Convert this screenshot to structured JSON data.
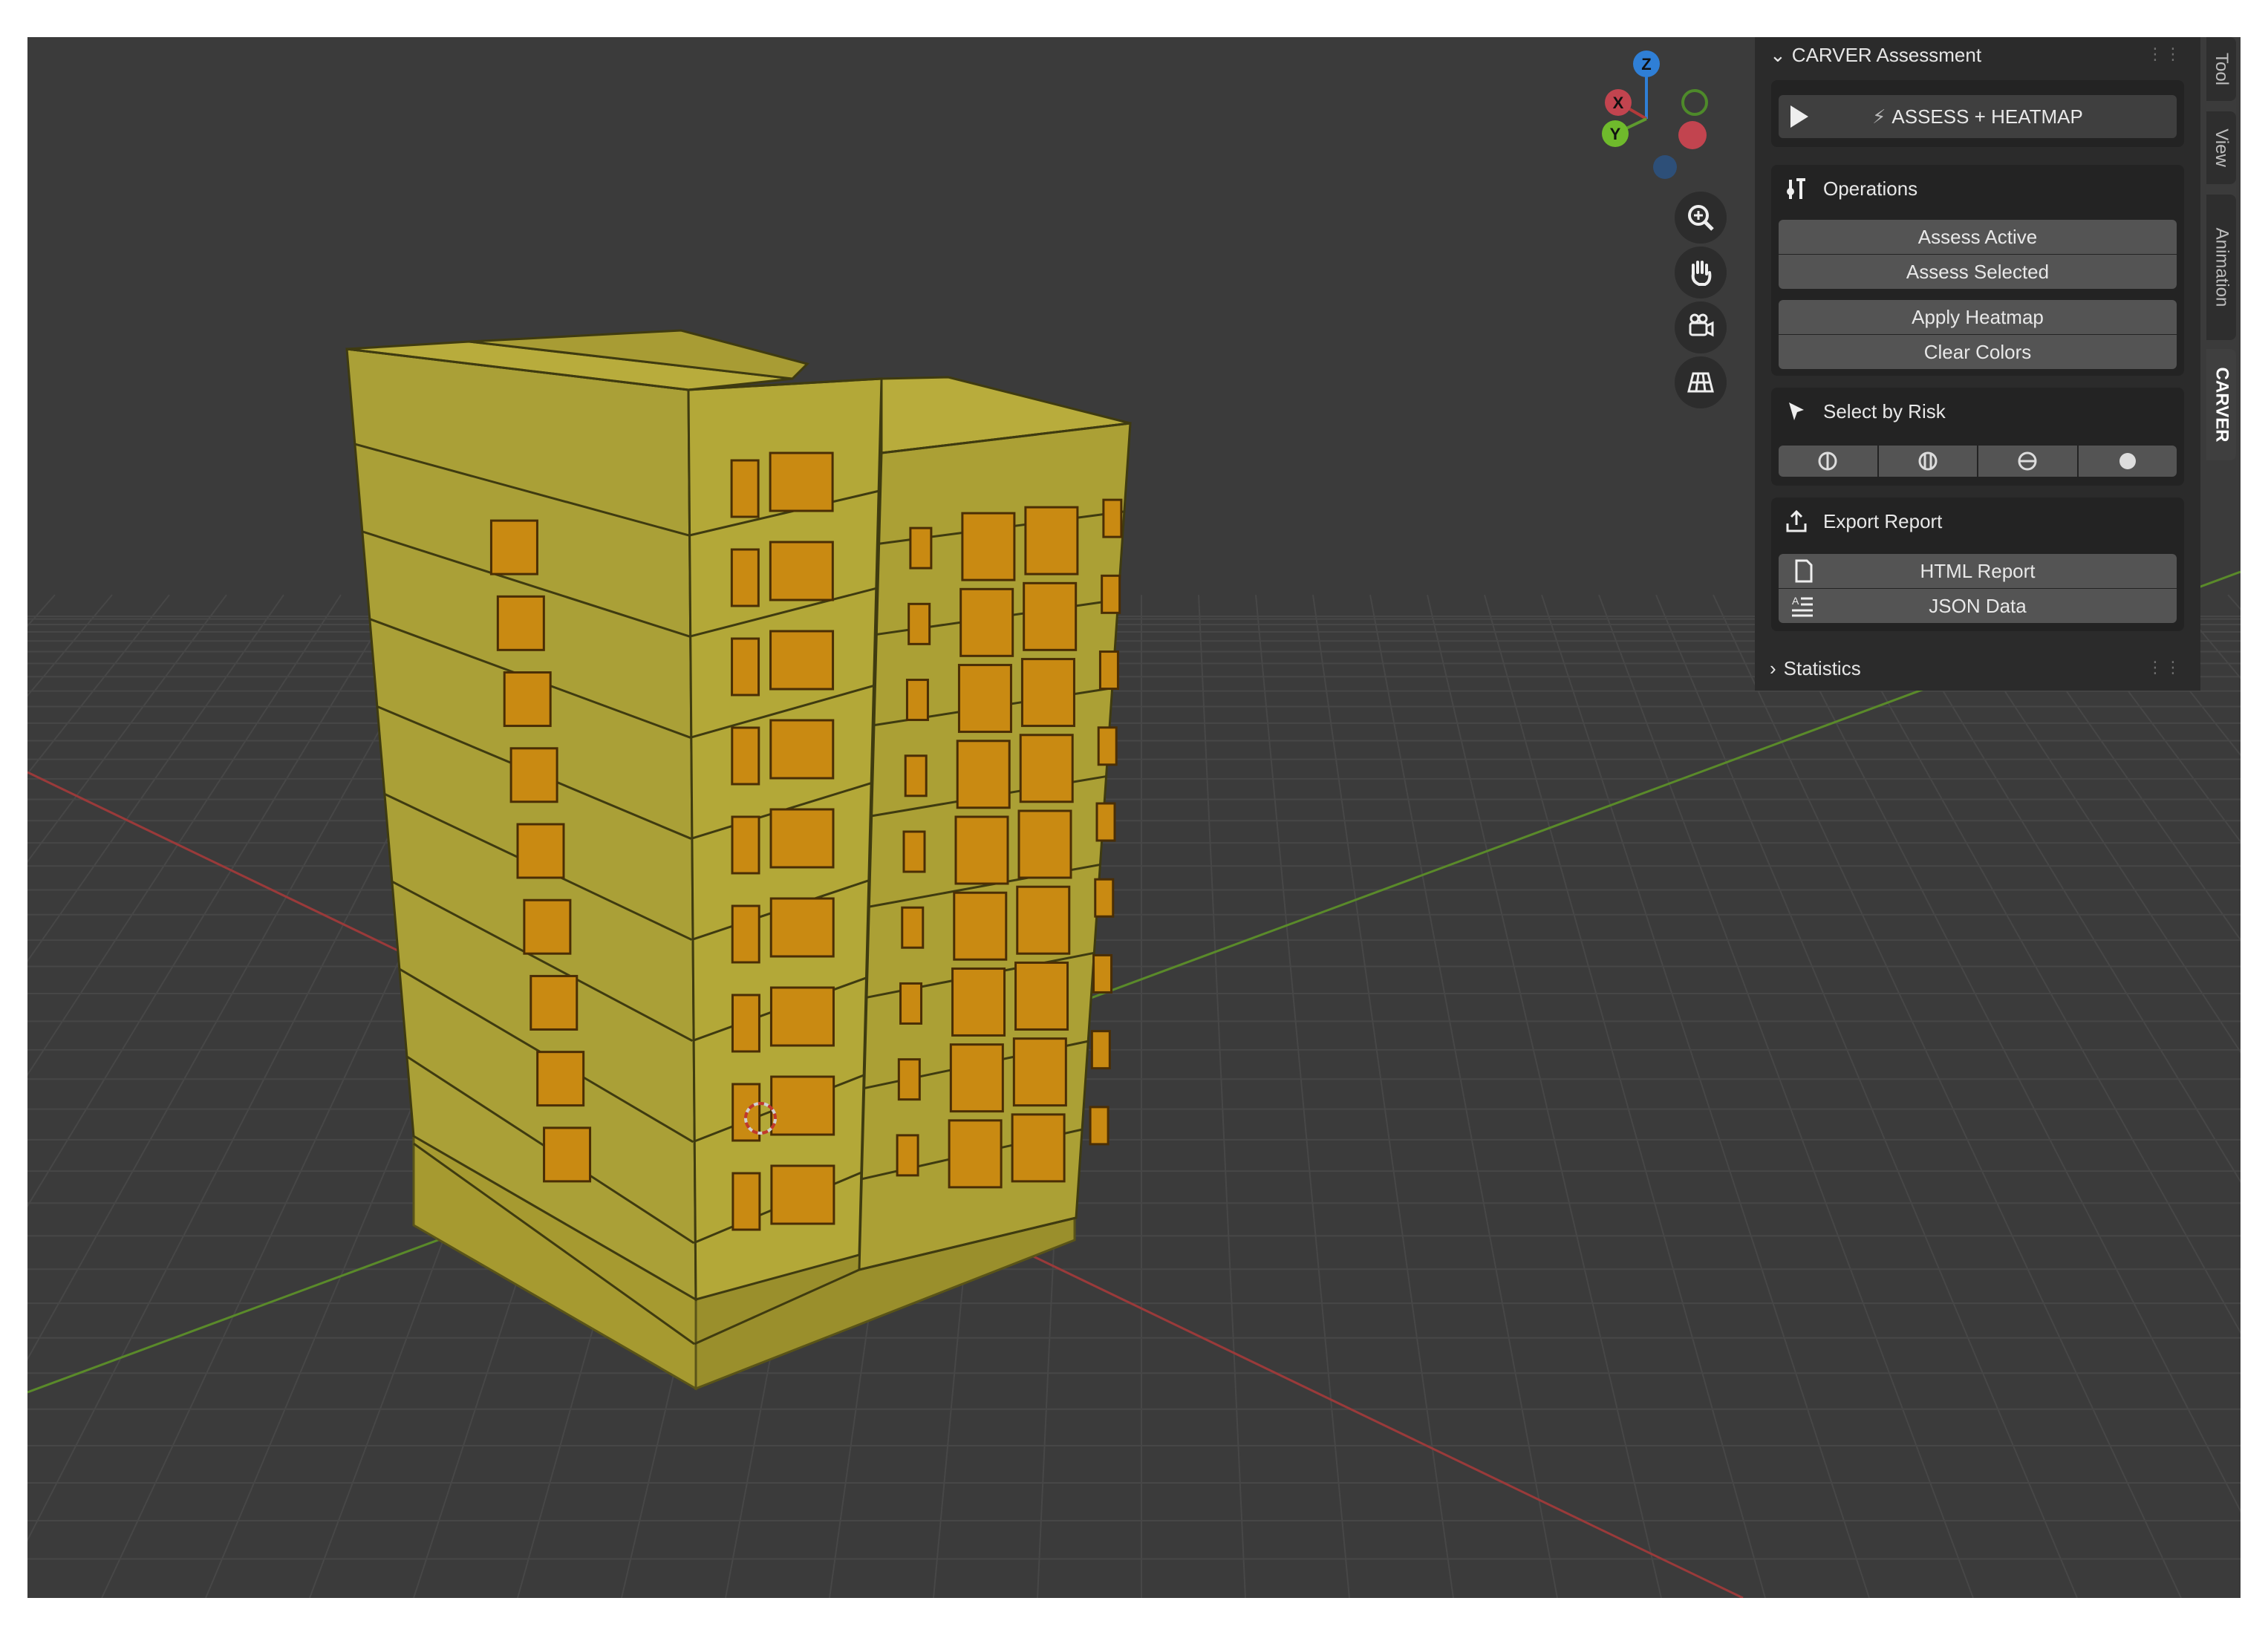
{
  "viewport": {
    "background": "#3b3b3b",
    "gizmo_axes": {
      "x": "X",
      "y": "Y",
      "z": "Z"
    },
    "nav_buttons": [
      "zoom-icon",
      "hand-icon",
      "camera-icon",
      "grid-icon"
    ]
  },
  "panel": {
    "title": "CARVER Assessment",
    "primary_button": "ASSESS + HEATMAP",
    "operations": {
      "heading": "Operations",
      "assess_active": "Assess Active",
      "assess_selected": "Assess Selected",
      "apply_heatmap": "Apply Heatmap",
      "clear_colors": "Clear Colors"
    },
    "select_by_risk": {
      "heading": "Select by Risk"
    },
    "export_report": {
      "heading": "Export Report",
      "html_report": "HTML Report",
      "json_data": "JSON Data"
    },
    "statistics": "Statistics"
  },
  "tabs": [
    "Tool",
    "View",
    "Animation",
    "CARVER"
  ],
  "colors": {
    "building": "#b3a532",
    "window": "#c98a12",
    "x_axis": "#b23a3a",
    "y_axis": "#5e9a2e",
    "z_axis": "#2f7fd6"
  }
}
